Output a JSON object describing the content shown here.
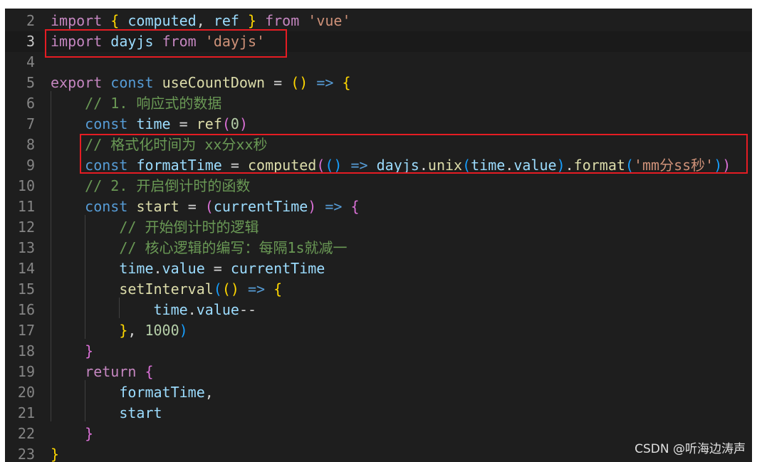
{
  "editor": {
    "lines": [
      {
        "num": "2",
        "tokens": [
          [
            "k",
            "import"
          ],
          [
            "t",
            " "
          ],
          [
            "p1",
            "{"
          ],
          [
            "t",
            " "
          ],
          [
            "v",
            "computed"
          ],
          [
            "t",
            ", "
          ],
          [
            "v",
            "ref"
          ],
          [
            "t",
            " "
          ],
          [
            "p1",
            "}"
          ],
          [
            "t",
            " "
          ],
          [
            "k",
            "from"
          ],
          [
            "t",
            " "
          ],
          [
            "s",
            "'vue'"
          ]
        ]
      },
      {
        "num": "3",
        "active": true,
        "tokens": [
          [
            "k",
            "import"
          ],
          [
            "t",
            " "
          ],
          [
            "v",
            "dayjs"
          ],
          [
            "t",
            " "
          ],
          [
            "k",
            "from"
          ],
          [
            "t",
            " "
          ],
          [
            "s",
            "'dayjs'"
          ]
        ]
      },
      {
        "num": "4",
        "tokens": []
      },
      {
        "num": "5",
        "tokens": [
          [
            "k",
            "export"
          ],
          [
            "t",
            " "
          ],
          [
            "b",
            "const"
          ],
          [
            "t",
            " "
          ],
          [
            "f",
            "useCountDown"
          ],
          [
            "t",
            " = "
          ],
          [
            "p1",
            "()"
          ],
          [
            "t",
            " "
          ],
          [
            "b",
            "=>"
          ],
          [
            "t",
            " "
          ],
          [
            "p1",
            "{"
          ]
        ]
      },
      {
        "num": "6",
        "tokens": [
          [
            "t",
            "    "
          ],
          [
            "c",
            "// 1. 响应式的数据"
          ]
        ]
      },
      {
        "num": "7",
        "tokens": [
          [
            "t",
            "    "
          ],
          [
            "b",
            "const"
          ],
          [
            "t",
            " "
          ],
          [
            "v",
            "time"
          ],
          [
            "t",
            " = "
          ],
          [
            "f",
            "ref"
          ],
          [
            "p2",
            "("
          ],
          [
            "n",
            "0"
          ],
          [
            "p2",
            ")"
          ]
        ]
      },
      {
        "num": "8",
        "tokens": [
          [
            "t",
            "    "
          ],
          [
            "c",
            "// 格式化时间为 xx分xx秒"
          ]
        ]
      },
      {
        "num": "9",
        "tokens": [
          [
            "t",
            "    "
          ],
          [
            "b",
            "const"
          ],
          [
            "t",
            " "
          ],
          [
            "v",
            "formatTime"
          ],
          [
            "t",
            " = "
          ],
          [
            "f",
            "computed"
          ],
          [
            "p2",
            "("
          ],
          [
            "p3",
            "()"
          ],
          [
            "t",
            " "
          ],
          [
            "b",
            "=>"
          ],
          [
            "t",
            " "
          ],
          [
            "v",
            "dayjs"
          ],
          [
            "t",
            "."
          ],
          [
            "f",
            "unix"
          ],
          [
            "p3",
            "("
          ],
          [
            "v",
            "time"
          ],
          [
            "t",
            "."
          ],
          [
            "v",
            "value"
          ],
          [
            "p3",
            ")"
          ],
          [
            "t",
            "."
          ],
          [
            "f",
            "format"
          ],
          [
            "p3",
            "("
          ],
          [
            "s",
            "'mm分ss秒'"
          ],
          [
            "p3",
            ")"
          ],
          [
            "p2",
            ")"
          ]
        ]
      },
      {
        "num": "10",
        "tokens": [
          [
            "t",
            "    "
          ],
          [
            "c",
            "// 2. 开启倒计时的函数"
          ]
        ]
      },
      {
        "num": "11",
        "tokens": [
          [
            "t",
            "    "
          ],
          [
            "b",
            "const"
          ],
          [
            "t",
            " "
          ],
          [
            "f",
            "start"
          ],
          [
            "t",
            " = "
          ],
          [
            "p2",
            "("
          ],
          [
            "v",
            "currentTime"
          ],
          [
            "p2",
            ")"
          ],
          [
            "t",
            " "
          ],
          [
            "b",
            "=>"
          ],
          [
            "t",
            " "
          ],
          [
            "p2",
            "{"
          ]
        ]
      },
      {
        "num": "12",
        "tokens": [
          [
            "t",
            "        "
          ],
          [
            "c",
            "// 开始倒计时的逻辑"
          ]
        ]
      },
      {
        "num": "13",
        "tokens": [
          [
            "t",
            "        "
          ],
          [
            "c",
            "// 核心逻辑的编写：每隔1s就减一"
          ]
        ]
      },
      {
        "num": "14",
        "tokens": [
          [
            "t",
            "        "
          ],
          [
            "v",
            "time"
          ],
          [
            "t",
            "."
          ],
          [
            "v",
            "value"
          ],
          [
            "t",
            " = "
          ],
          [
            "v",
            "currentTime"
          ]
        ]
      },
      {
        "num": "15",
        "tokens": [
          [
            "t",
            "        "
          ],
          [
            "f",
            "setInterval"
          ],
          [
            "p3",
            "("
          ],
          [
            "p1",
            "()"
          ],
          [
            "t",
            " "
          ],
          [
            "b",
            "=>"
          ],
          [
            "t",
            " "
          ],
          [
            "p1",
            "{"
          ]
        ]
      },
      {
        "num": "16",
        "tokens": [
          [
            "t",
            "            "
          ],
          [
            "v",
            "time"
          ],
          [
            "t",
            "."
          ],
          [
            "v",
            "value"
          ],
          [
            "t",
            "--"
          ]
        ]
      },
      {
        "num": "17",
        "tokens": [
          [
            "t",
            "        "
          ],
          [
            "p1",
            "}"
          ],
          [
            "t",
            ", "
          ],
          [
            "n",
            "1000"
          ],
          [
            "p3",
            ")"
          ]
        ]
      },
      {
        "num": "18",
        "tokens": [
          [
            "t",
            "    "
          ],
          [
            "p2",
            "}"
          ]
        ]
      },
      {
        "num": "19",
        "tokens": [
          [
            "t",
            "    "
          ],
          [
            "k",
            "return"
          ],
          [
            "t",
            " "
          ],
          [
            "p2",
            "{"
          ]
        ]
      },
      {
        "num": "20",
        "tokens": [
          [
            "t",
            "        "
          ],
          [
            "v",
            "formatTime"
          ],
          [
            "t",
            ","
          ]
        ]
      },
      {
        "num": "21",
        "tokens": [
          [
            "t",
            "        "
          ],
          [
            "v",
            "start"
          ]
        ]
      },
      {
        "num": "22",
        "tokens": [
          [
            "t",
            "    "
          ],
          [
            "p2",
            "}"
          ]
        ]
      },
      {
        "num": "23",
        "tokens": [
          [
            "p1",
            "}"
          ]
        ]
      }
    ]
  },
  "colors": {
    "background": "#1e1e1e",
    "highlight_box": "#e51c23"
  },
  "watermark": "CSDN @听海边涛声"
}
